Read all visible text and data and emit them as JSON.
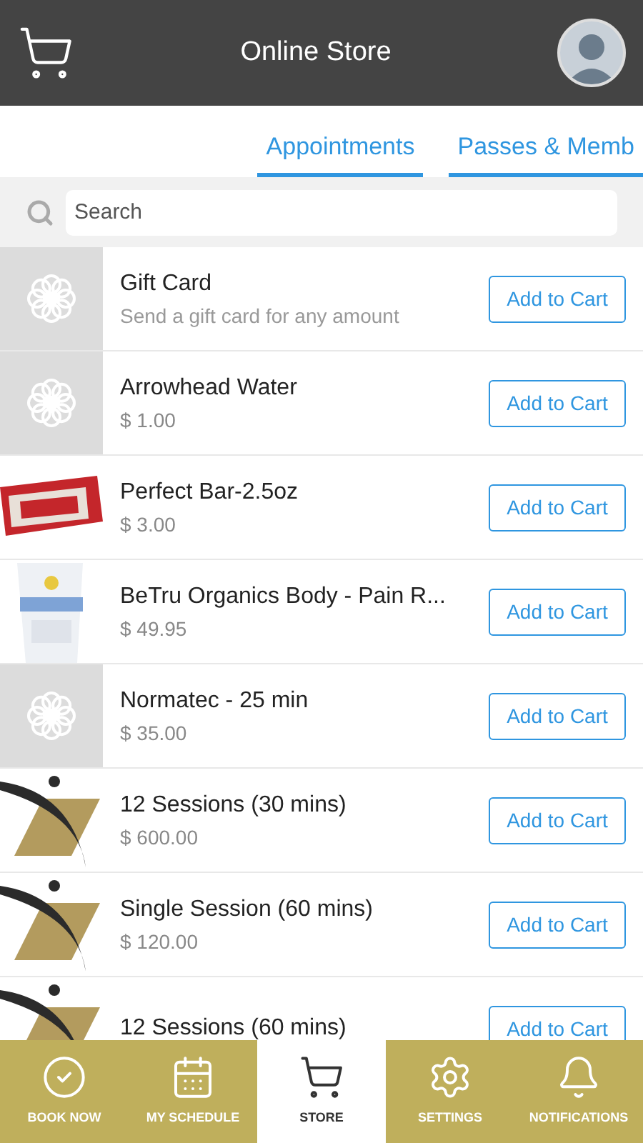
{
  "header": {
    "title": "Online Store"
  },
  "tabs": [
    {
      "label": "Appointments"
    },
    {
      "label": "Passes & Memb"
    }
  ],
  "search": {
    "placeholder": "Search"
  },
  "products": [
    {
      "name": "Gift Card",
      "description": "Send a gift card for any amount",
      "kind": "placeholder",
      "button": "Add to Cart"
    },
    {
      "name": "Arrowhead Water",
      "price": "$ 1.00",
      "kind": "placeholder",
      "button": "Add to Cart"
    },
    {
      "name": "Perfect Bar-2.5oz",
      "price": "$ 3.00",
      "kind": "picture",
      "button": "Add to Cart"
    },
    {
      "name": "BeTru Organics Body - Pain R...",
      "price": "$ 49.95",
      "kind": "picture",
      "button": "Add to Cart"
    },
    {
      "name": "Normatec - 25 min",
      "price": "$ 35.00",
      "kind": "placeholder",
      "button": "Add to Cart"
    },
    {
      "name": "12 Sessions (30 mins)",
      "price": "$ 600.00",
      "kind": "logo",
      "button": "Add to Cart"
    },
    {
      "name": "Single Session (60 mins)",
      "price": "$ 120.00",
      "kind": "logo",
      "button": "Add to Cart"
    },
    {
      "name": "12 Sessions (60 mins)",
      "kind": "logo",
      "button": "Add to Cart"
    }
  ],
  "nav": [
    {
      "label": "BOOK NOW",
      "kind": "check",
      "selected": false
    },
    {
      "label": "MY SCHEDULE",
      "kind": "calendar",
      "selected": false
    },
    {
      "label": "STORE",
      "kind": "cart",
      "selected": true
    },
    {
      "label": "SETTINGS",
      "kind": "gear",
      "selected": false
    },
    {
      "label": "NOTIFICATIONS",
      "kind": "bell",
      "selected": false
    }
  ]
}
